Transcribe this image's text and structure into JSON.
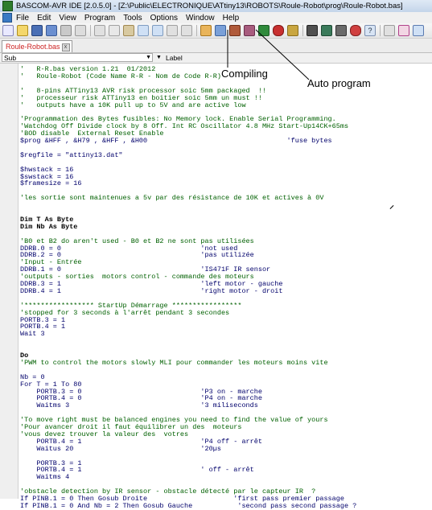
{
  "window": {
    "title": "BASCOM-AVR IDE [2.0.5.0] - [Z:\\Public\\ELECTRONIQUE\\ATtiny13\\ROBOTS\\Roule-Robot\\prog\\Roule-Robot.bas]"
  },
  "menu": [
    "File",
    "Edit",
    "View",
    "Program",
    "Tools",
    "Options",
    "Window",
    "Help"
  ],
  "tab": {
    "label": "Roule-Robot.bas",
    "close": "x"
  },
  "subbar": {
    "combo_value": "Sub",
    "label": "Label"
  },
  "annotations": {
    "compiling": "Compiling",
    "auto_program": "Auto program"
  },
  "code_lines": [
    {
      "text": "'   R-R.bas version 1.21  01/2012",
      "style": "comment"
    },
    {
      "text": "'   Roule-Robot (Code Name R-R - Nom de Code R-R)",
      "style": "comment"
    },
    {
      "text": "",
      "style": "normal"
    },
    {
      "text": "'   8-pins ATTiny13 AVR risk processor soic 5mm packaged  !!",
      "style": "comment"
    },
    {
      "text": "'   processeur risk ATTiny13 en boitier soic 5mm un must !!",
      "style": "comment"
    },
    {
      "text": "'   outputs have a 10K pull up to 5V and are active low",
      "style": "comment"
    },
    {
      "text": "",
      "style": "normal"
    },
    {
      "text": "'Programmation des Bytes fusibles: No Memory lock. Enable Serial Programming.",
      "style": "comment"
    },
    {
      "text": "'Watchdog Off Divide clock by 8 Off. Int RC Oscillator 4.8 MHz Start-Up14CK+65ms",
      "style": "comment"
    },
    {
      "text": "'BOD disable  External Reset Enable",
      "style": "comment"
    },
    {
      "text": "$prog &HFF , &H79 , &HFF , &H00                                  'fuse bytes",
      "style": "normal"
    },
    {
      "text": "",
      "style": "normal"
    },
    {
      "text": "$regfile = \"attiny13.dat\"",
      "style": "normal"
    },
    {
      "text": "",
      "style": "normal"
    },
    {
      "text": "$hwstack = 16",
      "style": "normal"
    },
    {
      "text": "$swstack = 16",
      "style": "normal"
    },
    {
      "text": "$framesize = 16",
      "style": "normal"
    },
    {
      "text": "",
      "style": "normal"
    },
    {
      "text": "'les sortie sont maintenues a 5v par des résistance de 10K et actives à 0V",
      "style": "comment"
    },
    {
      "text": "",
      "style": "normal"
    },
    {
      "text": "",
      "style": "normal"
    },
    {
      "text": "Dim T As Byte",
      "style": "bold"
    },
    {
      "text": "Dim Nb As Byte",
      "style": "bold"
    },
    {
      "text": "",
      "style": "normal"
    },
    {
      "text": "'B0 et B2 do aren't used - B0 et B2 ne sont pas utilisées",
      "style": "comment"
    },
    {
      "text": "DDRB.0 = 0                                  'not used",
      "style": "normal"
    },
    {
      "text": "DDRB.2 = 0                                  'pas utilizée",
      "style": "normal"
    },
    {
      "text": "'Input - Entrée",
      "style": "comment"
    },
    {
      "text": "DDRB.1 = 0                                  'IS471F IR sensor",
      "style": "normal"
    },
    {
      "text": "'outputs - sorties  motors control - commande des moteurs",
      "style": "comment"
    },
    {
      "text": "DDRB.3 = 1                                  'left motor - gauche",
      "style": "normal"
    },
    {
      "text": "DDRB.4 = 1                                  'right motor - droit",
      "style": "normal"
    },
    {
      "text": "",
      "style": "normal"
    },
    {
      "text": "'***************** StartUp Démarrage *****************",
      "style": "comment"
    },
    {
      "text": "'stopped for 3 seconds à l'arrêt pendant 3 secondes",
      "style": "comment"
    },
    {
      "text": "PORTB.3 = 1",
      "style": "normal"
    },
    {
      "text": "PORTB.4 = 1",
      "style": "normal"
    },
    {
      "text": "Wait 3",
      "style": "normal"
    },
    {
      "text": "",
      "style": "normal"
    },
    {
      "text": "",
      "style": "normal"
    },
    {
      "text": "Do",
      "style": "bold"
    },
    {
      "text": "'PWM to control the motors slowly MLI pour commander les moteurs moins vite",
      "style": "comment"
    },
    {
      "text": "",
      "style": "normal"
    },
    {
      "text": "Nb = 0",
      "style": "normal"
    },
    {
      "text": "For T = 1 To 80",
      "style": "normal"
    },
    {
      "text": "    PORTB.3 = 0                             'P3 on - marche",
      "style": "normal"
    },
    {
      "text": "    PORTB.4 = 0                             'P4 on - marche",
      "style": "normal"
    },
    {
      "text": "    Waitms 3                                '3 miliseconds",
      "style": "normal"
    },
    {
      "text": "",
      "style": "normal"
    },
    {
      "text": "'To move right must be balanced engines you need to find the value of yours",
      "style": "comment"
    },
    {
      "text": "'Pour avancer droit il faut équilibrer un des  moteurs",
      "style": "comment"
    },
    {
      "text": "'vous devez trouver la valeur des  votres",
      "style": "comment"
    },
    {
      "text": "    PORTB.4 = 1                             'P4 off - arrêt",
      "style": "normal"
    },
    {
      "text": "    Waitus 20                               '20µs",
      "style": "normal"
    },
    {
      "text": "",
      "style": "normal"
    },
    {
      "text": "    PORTB.3 = 1",
      "style": "normal"
    },
    {
      "text": "    PORTB.4 = 1                             ' off - arrêt",
      "style": "normal"
    },
    {
      "text": "    Waitms 4",
      "style": "normal"
    },
    {
      "text": "",
      "style": "normal"
    },
    {
      "text": "'obstacle detection by IR sensor - obstacle détecté par le capteur IR  ?",
      "style": "comment"
    },
    {
      "text": "If PINB.1 = 0 Then Gosub Droite                     'first pass premier passage",
      "style": "normal"
    },
    {
      "text": "If PINB.1 = 0 And Nb = 2 Then Gosub Gauche           'second pass second passage ?",
      "style": "normal"
    }
  ]
}
